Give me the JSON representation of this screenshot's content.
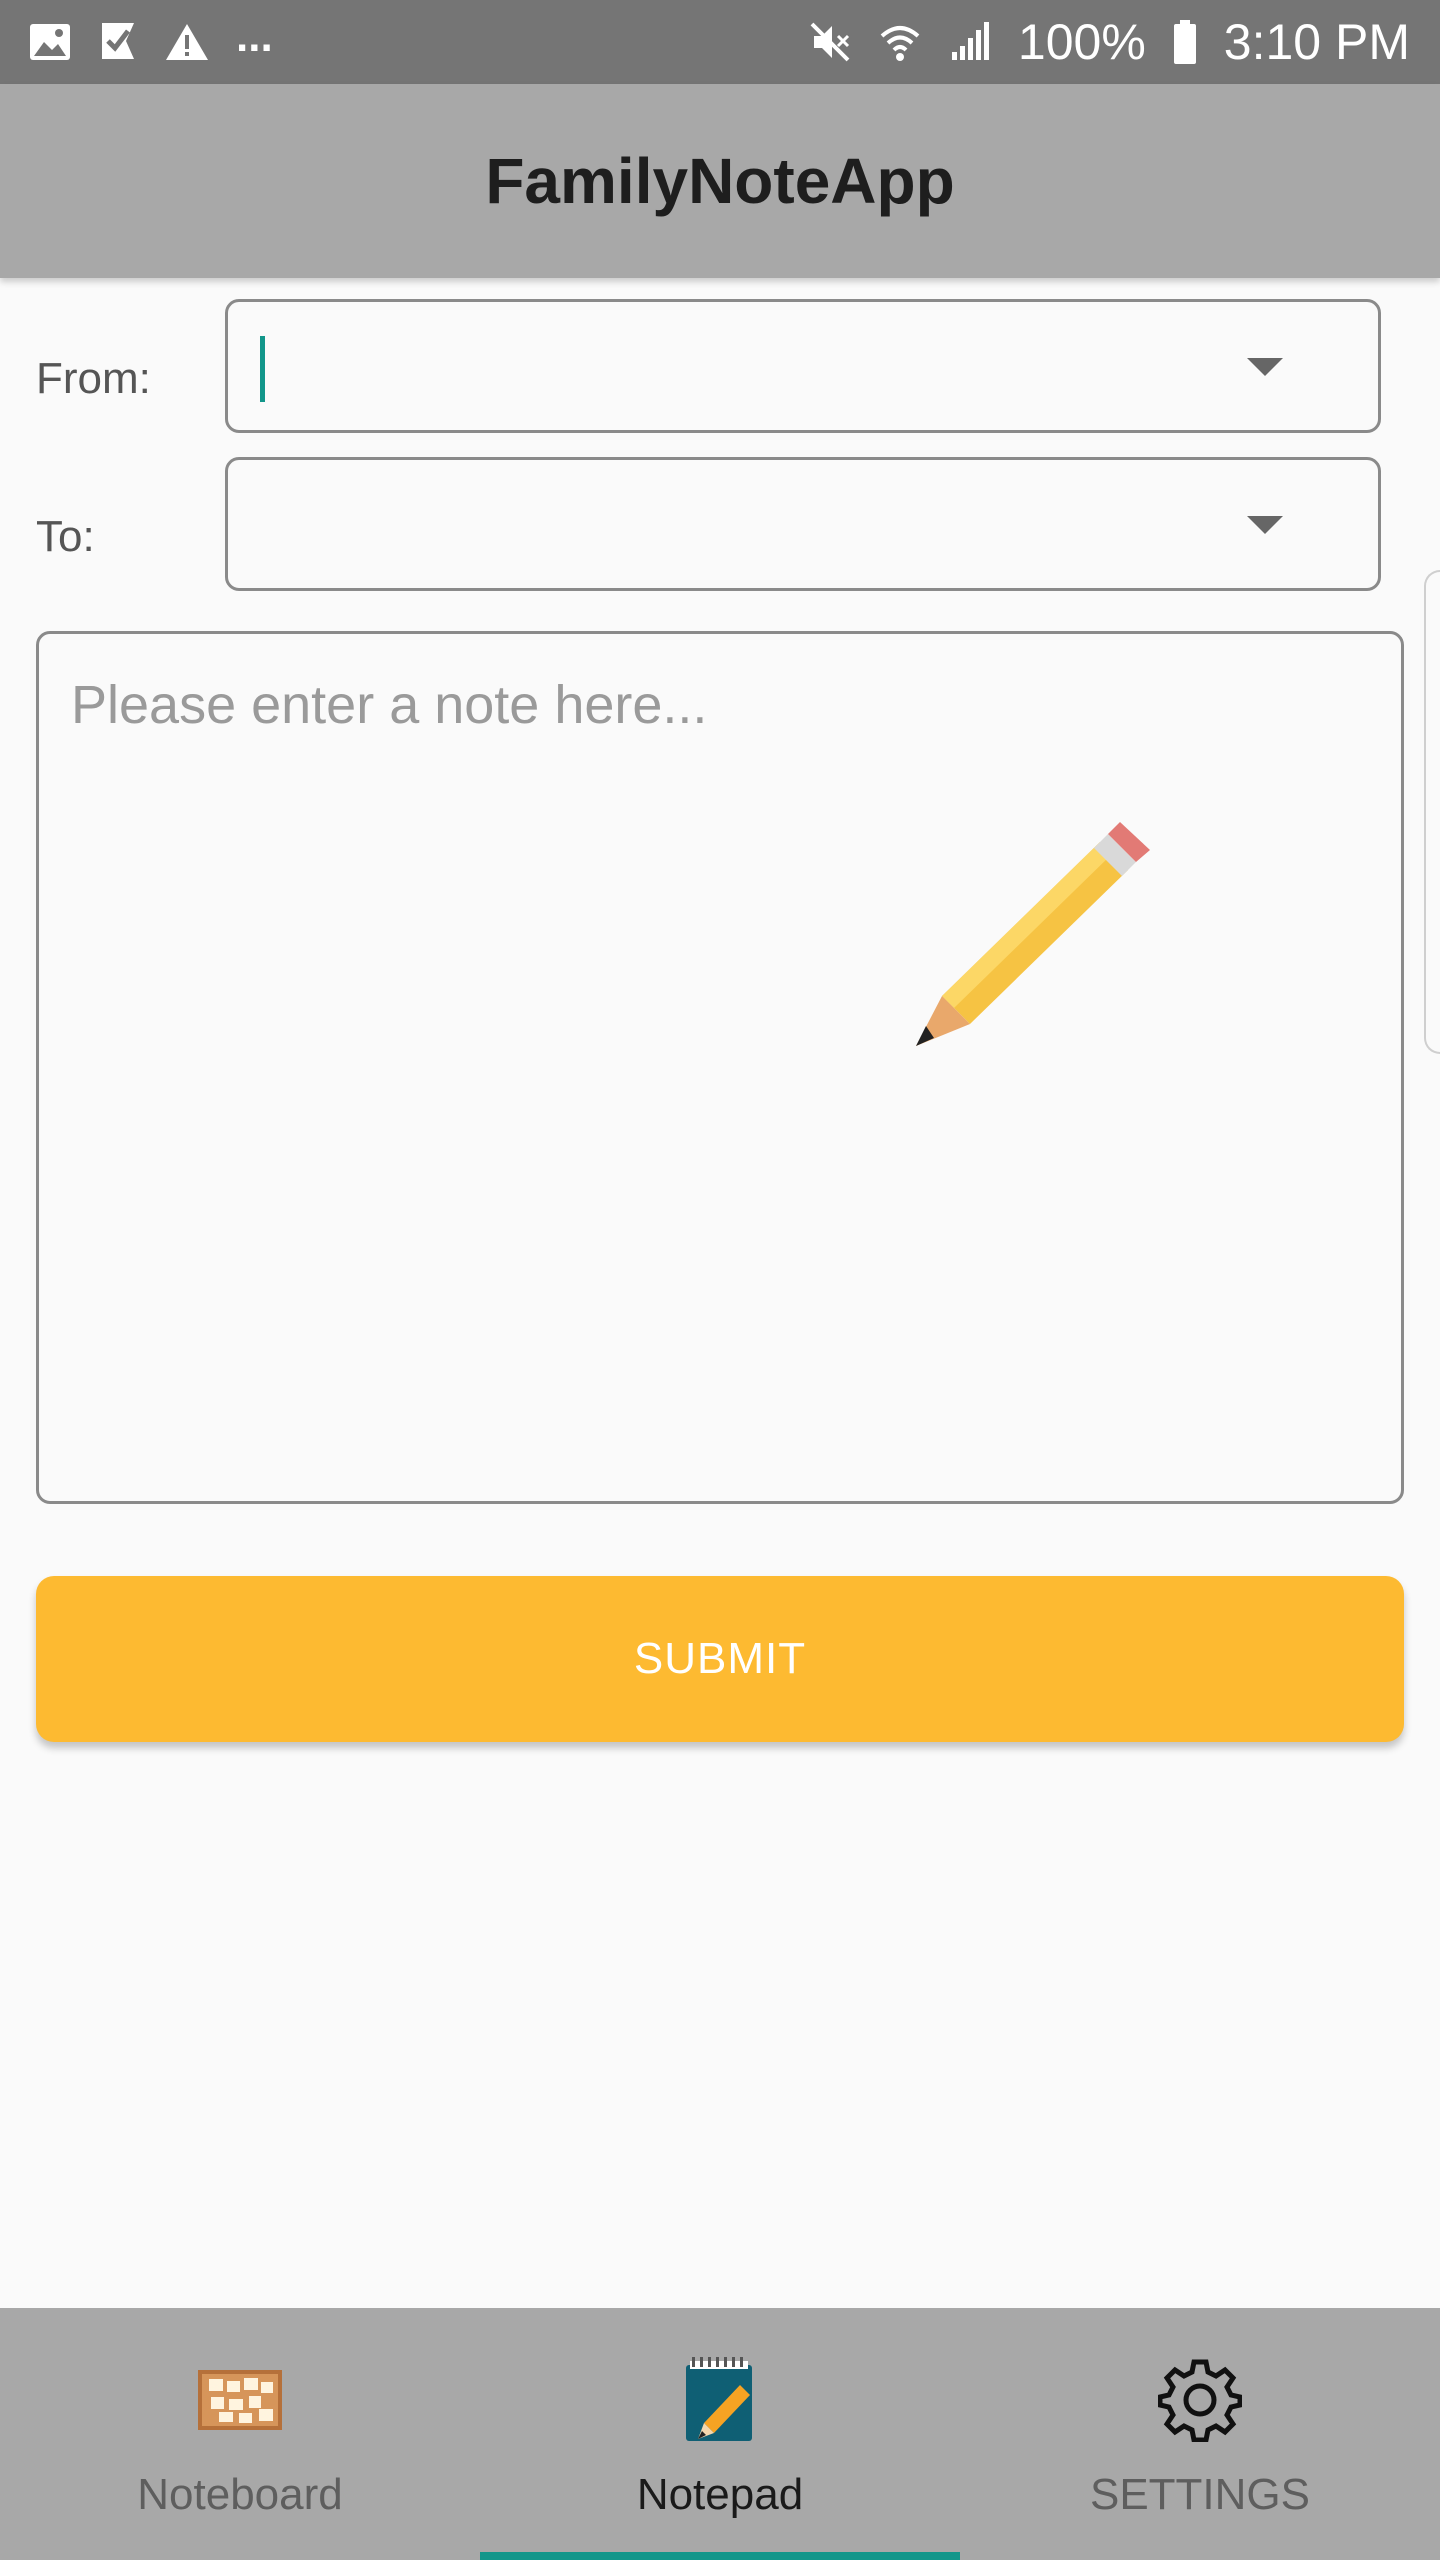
{
  "status_bar": {
    "left_icons": [
      "image-icon",
      "check-flag-icon",
      "warning-icon"
    ],
    "overflow": "...",
    "right_icons": [
      "mute-icon",
      "wifi-icon",
      "signal-icon",
      "battery-icon"
    ],
    "battery": "100%",
    "time": "3:10 PM"
  },
  "app_bar": {
    "title": "FamilyNoteApp"
  },
  "form": {
    "from_label": "From:",
    "from_value": "",
    "to_label": "To:",
    "to_value": "",
    "note_placeholder": "Please enter a note here...",
    "note_value": "",
    "submit_label": "SUBMIT"
  },
  "bottom_nav": {
    "items": [
      {
        "label": "Noteboard",
        "icon": "corkboard-icon",
        "active": false
      },
      {
        "label": "Notepad",
        "icon": "notepad-icon",
        "active": true
      },
      {
        "label": "SETTINGS",
        "icon": "gear-icon",
        "active": false
      }
    ]
  },
  "colors": {
    "status_bar": "#757575",
    "app_bar": "#a8a8a8",
    "accent": "#12968a",
    "submit": "#fdba31",
    "bottom_nav": "#a8a8a8"
  }
}
